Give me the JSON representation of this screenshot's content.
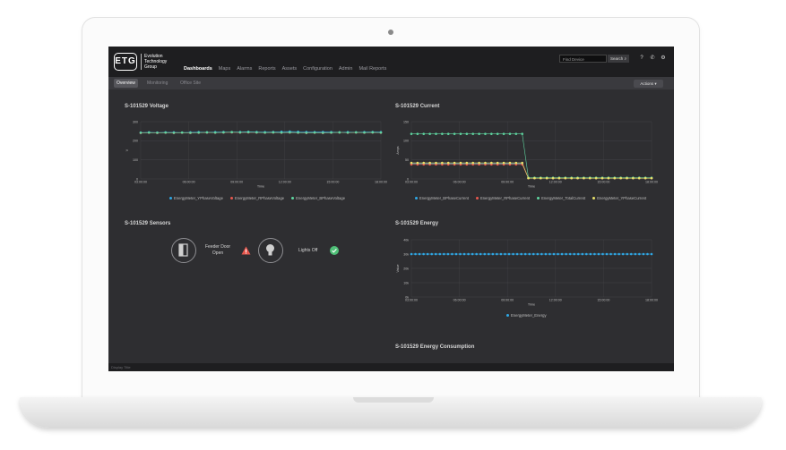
{
  "logo": {
    "mark": "ETG",
    "name_line1": "Evolution",
    "name_line2": "Technology",
    "name_line3": "Group"
  },
  "nav": [
    {
      "label": "Dashboards",
      "active": true
    },
    {
      "label": "Maps"
    },
    {
      "label": "Alarms"
    },
    {
      "label": "Reports"
    },
    {
      "label": "Assets"
    },
    {
      "label": "Configuration"
    },
    {
      "label": "Admin"
    },
    {
      "label": "Mail Reports"
    }
  ],
  "search": {
    "placeholder": "Find Device",
    "button_label": "Search"
  },
  "tabs": [
    {
      "label": "Overview",
      "active": true
    },
    {
      "label": "Monitoring"
    },
    {
      "label": "Office Site"
    }
  ],
  "actions_label": "Actions",
  "panels": {
    "voltage_title": "S-101529 Voltage",
    "current_title": "S-101529 Current",
    "sensors_title": "S-101529 Sensors",
    "energy_title": "S-101529 Energy",
    "consumption_title": "S-101529 Energy Consumption"
  },
  "sensors": {
    "feeder_line1": "Feeder Door",
    "feeder_line2": "Open",
    "lights_label": "Lights Off"
  },
  "footer_text": "Display Title",
  "colors": {
    "blue": "#2ea8e6",
    "red": "#e8584e",
    "green": "#5fd6a0",
    "yellow": "#e8e06a",
    "grid": "#4a4a4e",
    "text": "#bdbdbd"
  },
  "chart_data": [
    {
      "type": "line",
      "title": "S-101529 Voltage",
      "xlabel": "Time",
      "ylabel": "V",
      "x_ticks": [
        "03:00:00",
        "06:00:00",
        "09:00:00",
        "12:00:00",
        "15:00:00",
        "18:00:00"
      ],
      "ylim": [
        0,
        300
      ],
      "y_ticks": [
        "0",
        "100",
        "200",
        "300"
      ],
      "series": [
        {
          "name": "EnergyMeter_YPhaseVoltage",
          "color": "#2ea8e6",
          "values": [
            243,
            244,
            243,
            244,
            244,
            243,
            244,
            245,
            244,
            245,
            246,
            245,
            246,
            247,
            246,
            245,
            246,
            247,
            248,
            247,
            246,
            245,
            246,
            245,
            244,
            245,
            244,
            245,
            246,
            245
          ]
        },
        {
          "name": "EnergyMeter_RPhaseVoltage",
          "color": "#e8584e",
          "values": [
            241,
            242,
            241,
            242,
            241,
            242,
            241,
            242,
            243,
            242,
            243,
            244,
            243,
            244,
            243,
            242,
            243,
            242,
            243,
            242,
            241,
            242,
            241,
            242,
            243,
            242,
            243,
            242,
            243,
            242
          ]
        },
        {
          "name": "EnergyMeter_BPhaseVoltage",
          "color": "#5fd6a0",
          "values": [
            242,
            243,
            242,
            243,
            242,
            243,
            242,
            243,
            244,
            243,
            244,
            245,
            244,
            245,
            244,
            243,
            244,
            243,
            244,
            243,
            242,
            243,
            242,
            243,
            244,
            243,
            244,
            243,
            244,
            243
          ]
        }
      ]
    },
    {
      "type": "line",
      "title": "S-101529 Current",
      "xlabel": "Time",
      "ylabel": "Amps",
      "x_ticks": [
        "03:00:00",
        "06:00:00",
        "09:00:00",
        "12:00:00",
        "15:00:00",
        "18:00:00"
      ],
      "ylim": [
        0,
        150
      ],
      "y_ticks": [
        "0",
        "50",
        "100",
        "150"
      ],
      "series": [
        {
          "name": "EnergyMeter_BPhaseCurrent",
          "color": "#2ea8e6",
          "values": [
            40,
            40,
            40,
            40,
            40,
            40,
            40,
            40,
            40,
            40,
            40,
            40,
            40,
            40,
            40,
            40,
            40,
            40,
            40,
            2,
            2,
            2,
            2,
            2,
            2,
            2,
            2,
            2,
            2,
            2,
            2,
            2,
            2,
            2,
            2,
            2,
            2,
            2,
            2,
            2
          ]
        },
        {
          "name": "EnergyMeter_RPhaseCurrent",
          "color": "#e8584e",
          "values": [
            38,
            38,
            38,
            38,
            38,
            38,
            38,
            38,
            38,
            38,
            38,
            38,
            38,
            38,
            38,
            38,
            38,
            38,
            38,
            2,
            2,
            2,
            2,
            2,
            2,
            2,
            2,
            2,
            2,
            2,
            2,
            2,
            2,
            2,
            2,
            2,
            2,
            2,
            2,
            2
          ]
        },
        {
          "name": "EnergyMeter_TotalCurrent",
          "color": "#5fd6a0",
          "values": [
            118,
            118,
            118,
            118,
            118,
            118,
            118,
            118,
            118,
            118,
            118,
            118,
            118,
            118,
            118,
            118,
            118,
            118,
            118,
            3,
            3,
            3,
            3,
            3,
            3,
            3,
            3,
            3,
            3,
            3,
            3,
            3,
            3,
            3,
            3,
            3,
            3,
            3,
            3,
            3
          ]
        },
        {
          "name": "EnergyMeter_YPhaseCurrent",
          "color": "#e8e06a",
          "values": [
            42,
            42,
            42,
            42,
            42,
            42,
            42,
            42,
            42,
            42,
            42,
            42,
            42,
            42,
            42,
            42,
            42,
            42,
            42,
            2,
            2,
            2,
            2,
            2,
            2,
            2,
            2,
            2,
            2,
            2,
            2,
            2,
            2,
            2,
            2,
            2,
            2,
            2,
            2,
            2
          ]
        }
      ]
    },
    {
      "type": "line",
      "title": "S-101529 Energy",
      "xlabel": "Time",
      "ylabel": "Value",
      "x_ticks": [
        "03:00:00",
        "06:00:00",
        "09:00:00",
        "12:00:00",
        "15:00:00",
        "18:00:00"
      ],
      "ylim": [
        0,
        40
      ],
      "y_ticks": [
        "0k",
        "10k",
        "20k",
        "30k",
        "40k"
      ],
      "series": [
        {
          "name": "EnergyMeter_Energy",
          "color": "#2ea8e6",
          "values": [
            30,
            30,
            30,
            30,
            30,
            30,
            30,
            30,
            30,
            30,
            30,
            30,
            30,
            30,
            30,
            30,
            30,
            30,
            30,
            30,
            30,
            30,
            30,
            30,
            30,
            30,
            30,
            30,
            30,
            30,
            30,
            30,
            30,
            30,
            30,
            30,
            30,
            30,
            30,
            30,
            30,
            30,
            30,
            30,
            30,
            30,
            30,
            30,
            30,
            30,
            30,
            30,
            30,
            30,
            30,
            30,
            30,
            30,
            30,
            30
          ]
        }
      ]
    }
  ]
}
